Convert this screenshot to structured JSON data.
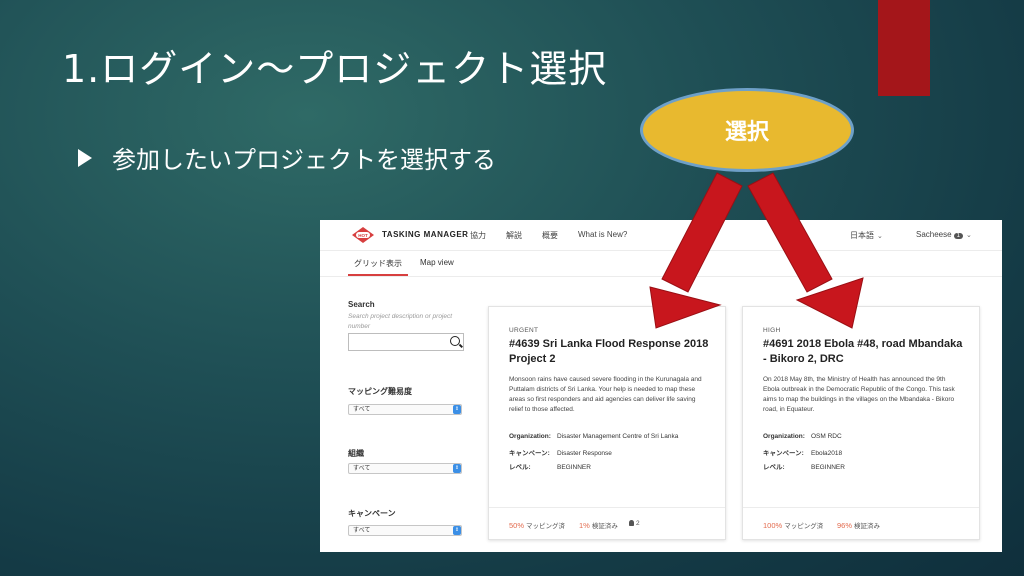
{
  "slide": {
    "title": "1.ログイン～プロジェクト選択",
    "bullet": "参加したいプロジェクトを選択する",
    "callout": "選択"
  },
  "app": {
    "brand": "TASKING MANAGER",
    "logo_text": "HOT",
    "nav": [
      "協力",
      "解説",
      "概要",
      "What is New?"
    ],
    "language": "日本語",
    "user": "Sacheese",
    "user_badge": "1",
    "tabs": [
      "グリッド表示",
      "Map view"
    ],
    "active_tab": "グリッド表示"
  },
  "filters": {
    "search_label": "Search",
    "search_hint": "Search project description or project number",
    "mapping_difficulty_label": "マッピング難易度",
    "mapping_difficulty_value": "すべて",
    "organization_label": "組織",
    "organization_value": "すべて",
    "campaign_label": "キャンペーン",
    "campaign_value": "すべて"
  },
  "projects": [
    {
      "priority": "URGENT",
      "title": "#4639 Sri Lanka Flood Response 2018 Project 2",
      "description": "Monsoon rains have caused severe flooding in the Kurunagala and Puttalam districts of Sri Lanka. Your help is needed to map these areas so first responders and aid agencies can deliver life saving relief to those affected.",
      "organization_label": "Organization:",
      "organization": "Disaster Management Centre of Sri Lanka",
      "campaign_label": "キャンペーン:",
      "campaign": "Disaster Response",
      "level_label": "レベル:",
      "level": "BEGINNER",
      "mapped_pct": "50%",
      "mapped_label": "マッピング済",
      "validated_pct": "1%",
      "validated_label": "検証済み",
      "contributors": "2"
    },
    {
      "priority": "HIGH",
      "title": "#4691 2018 Ebola #48, road Mbandaka - Bikoro 2, DRC",
      "description": "On 2018 May 8th, the Ministry of Health has announced the 9th Ebola outbreak in the Democratic Republic of the Congo. This task aims to map the buildings in the villages on the Mbandaka - Bikoro road, in Equateur.",
      "organization_label": "Organization:",
      "organization": "OSM RDC",
      "campaign_label": "キャンペーン:",
      "campaign": "Ebola2018",
      "level_label": "レベル:",
      "level": "BEGINNER",
      "mapped_pct": "100%",
      "mapped_label": "マッピング済",
      "validated_pct": "96%",
      "validated_label": "検証済み"
    }
  ],
  "colors": {
    "accent_red": "#a4161a",
    "callout_fill": "#e8b92f",
    "arrow_red": "#c8161d",
    "percent_orange": "#e36b4e"
  }
}
